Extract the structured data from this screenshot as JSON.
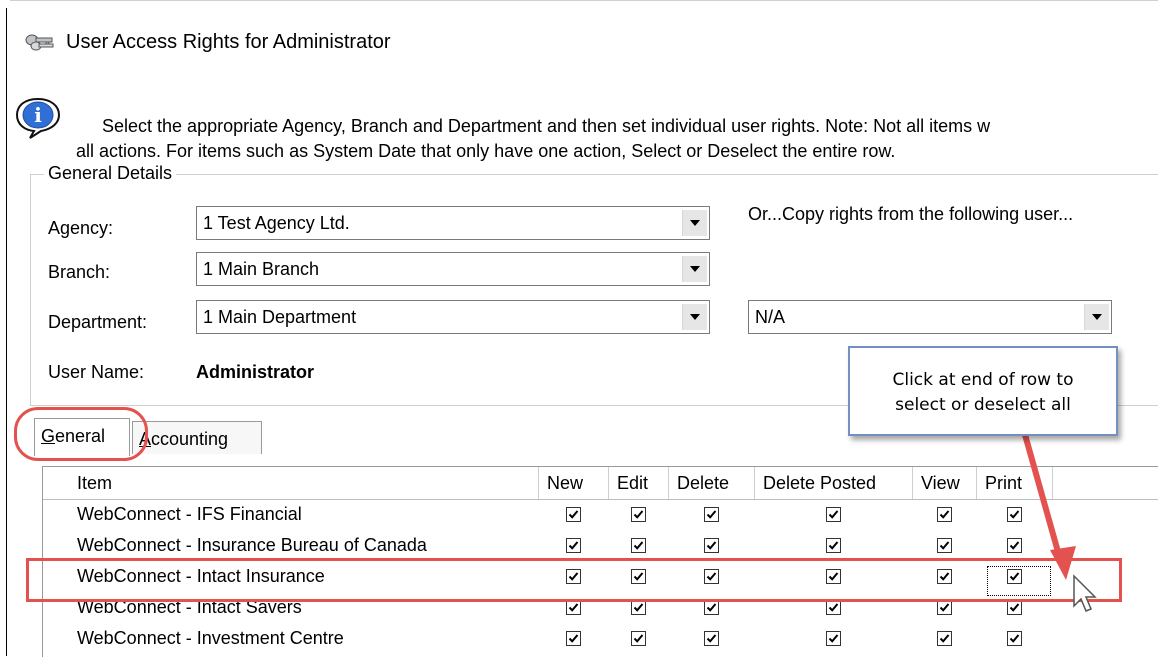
{
  "window": {
    "title": "User Access Rights for Administrator"
  },
  "info": {
    "line1": "Select the appropriate Agency, Branch and Department and then set individual user rights.  Note:  Not all items w",
    "line2": "all actions.  For items such as System Date that only have one action, Select or Deselect the entire row."
  },
  "general_details": {
    "legend": "General Details",
    "agency_label": "Agency:",
    "agency_value": "1 Test Agency Ltd.",
    "branch_label": "Branch:",
    "branch_value": "1 Main Branch",
    "department_label": "Department:",
    "department_value": "1 Main Department",
    "copy_label": "Or...Copy rights from the following user...",
    "copy_value": "N/A",
    "username_label": "User Name:",
    "username_value": "Administrator"
  },
  "tooltip": {
    "line1": "Click at end of row to",
    "line2": "select or deselect all"
  },
  "tabs": [
    {
      "label_first": "G",
      "label_rest": "eneral"
    },
    {
      "label_first": "A",
      "label_rest": "ccounting"
    }
  ],
  "grid": {
    "columns": [
      "Item",
      "New",
      "Edit",
      "Delete",
      "Delete Posted",
      "View",
      "Print"
    ],
    "rows": [
      {
        "item": "WebConnect - IFS Financial",
        "checks": [
          true,
          true,
          true,
          true,
          true,
          true
        ]
      },
      {
        "item": "WebConnect - Insurance Bureau of Canada",
        "checks": [
          true,
          true,
          true,
          true,
          true,
          true
        ]
      },
      {
        "item": "WebConnect - Intact Insurance",
        "checks": [
          true,
          true,
          true,
          true,
          true,
          true
        ]
      },
      {
        "item": "WebConnect - Intact Savers",
        "checks": [
          true,
          true,
          true,
          true,
          true,
          true
        ]
      },
      {
        "item": "WebConnect - Investment Centre",
        "checks": [
          true,
          true,
          true,
          true,
          true,
          true
        ]
      }
    ]
  },
  "colors": {
    "annotation": "#e3524f",
    "tooltip_border": "#7390c0"
  }
}
